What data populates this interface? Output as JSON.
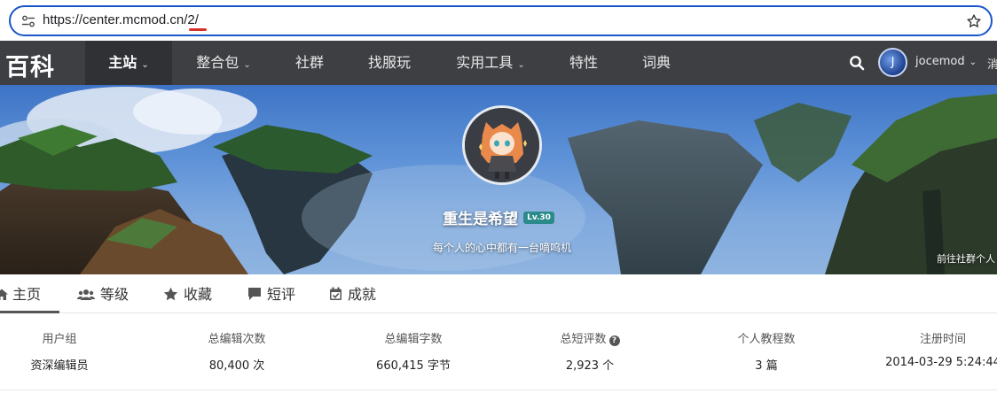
{
  "browser": {
    "url": "https://center.mcmod.cn/2/"
  },
  "nav": {
    "logo": "百科",
    "items": [
      {
        "label": "主站",
        "has_caret": true
      },
      {
        "label": "整合包",
        "has_caret": true
      },
      {
        "label": "社群",
        "has_caret": false
      },
      {
        "label": "找服玩",
        "has_caret": false
      },
      {
        "label": "实用工具",
        "has_caret": true
      },
      {
        "label": "特性",
        "has_caret": false
      },
      {
        "label": "词典",
        "has_caret": false
      }
    ],
    "user": {
      "avatar_letter": "J",
      "name": "jocemod"
    },
    "trailing_cut": "消"
  },
  "profile": {
    "name": "重生是希望",
    "level": "Lv.30",
    "signature": "每个人的心中都有一台嘀呜机",
    "community_link": "前往社群个人"
  },
  "tabs": [
    {
      "label": "主页",
      "icon": "home-icon"
    },
    {
      "label": "等级",
      "icon": "users-icon"
    },
    {
      "label": "收藏",
      "icon": "star-icon"
    },
    {
      "label": "短评",
      "icon": "comment-icon"
    },
    {
      "label": "成就",
      "icon": "calendar-check-icon"
    }
  ],
  "stats": [
    {
      "label": "用户组",
      "value": "资深编辑员",
      "help": false
    },
    {
      "label": "总编辑次数",
      "value": "80,400 次",
      "help": false
    },
    {
      "label": "总编辑字数",
      "value": "660,415 字节",
      "help": false
    },
    {
      "label": "总短评数",
      "value": "2,923 个",
      "help": true
    },
    {
      "label": "个人教程数",
      "value": "3 篇",
      "help": false
    },
    {
      "label": "注册时间",
      "value": "2014-03-29 5:24:44",
      "help": false
    }
  ],
  "colors": {
    "nav_bg": "#3d3f43",
    "nav_active_bg": "#2f3135",
    "url_border": "#1a56c7",
    "level_badge": "#2b8a8a"
  }
}
